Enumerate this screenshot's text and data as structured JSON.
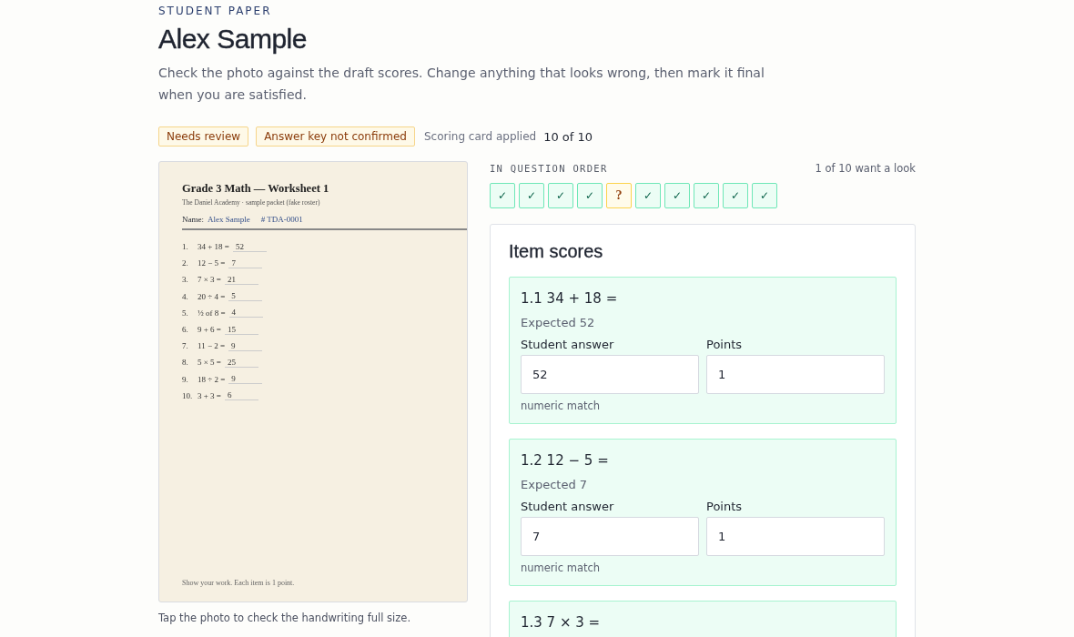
{
  "eyebrow": "STUDENT PAPER",
  "title": "Alex Sample",
  "intro": "Check the photo against the draft scores. Change anything that looks wrong, then mark it final when you are satisfied.",
  "badges": [
    "Needs review",
    "Answer key not confirmed"
  ],
  "scoring": {
    "label": "Scoring card applied",
    "value": "10 of 10"
  },
  "worksheet": {
    "title": "Grade 3 Math — Worksheet 1",
    "subtitle": "The Daniel Academy · sample packet (fake roster)",
    "name_label": "Name:",
    "name": "Alex Sample",
    "id": "# TDA-0001",
    "problems": [
      {
        "number": "1.",
        "question": "34 + 18 =",
        "answer": "52"
      },
      {
        "number": "2.",
        "question": "12 − 5 =",
        "answer": "7"
      },
      {
        "number": "3.",
        "question": "7 × 3 =",
        "answer": "21"
      },
      {
        "number": "4.",
        "question": "20 ÷ 4 =",
        "answer": "5"
      },
      {
        "number": "5.",
        "question": "½ of 8 =",
        "answer": "4"
      },
      {
        "number": "6.",
        "question": "9 + 6 =",
        "answer": "15"
      },
      {
        "number": "7.",
        "question": "11 − 2 =",
        "answer": "9"
      },
      {
        "number": "8.",
        "question": "5 × 5 =",
        "answer": "25"
      },
      {
        "number": "9.",
        "question": "18 ÷ 2 =",
        "answer": "9"
      },
      {
        "number": "10.",
        "question": "3 + 3 =",
        "answer": "6"
      }
    ],
    "footer": "Show your work. Each item is 1 point."
  },
  "photo_hint": "Tap the photo to check the handwriting full size.",
  "order": {
    "label": "IN QUESTION ORDER",
    "summary": "1 of 10 want a look",
    "chips": [
      {
        "kind": "ok",
        "glyph": "✓"
      },
      {
        "kind": "ok",
        "glyph": "✓"
      },
      {
        "kind": "ok",
        "glyph": "✓"
      },
      {
        "kind": "ok",
        "glyph": "✓"
      },
      {
        "kind": "flag",
        "glyph": "?"
      },
      {
        "kind": "ok",
        "glyph": "✓"
      },
      {
        "kind": "ok",
        "glyph": "✓"
      },
      {
        "kind": "ok",
        "glyph": "✓"
      },
      {
        "kind": "ok",
        "glyph": "✓"
      },
      {
        "kind": "ok",
        "glyph": "✓"
      }
    ]
  },
  "items": {
    "title": "Item scores",
    "list": [
      {
        "heading": "1.1 34 + 18 =",
        "expected": "Expected 52",
        "answer_label": "Student answer",
        "answer": "52",
        "points_label": "Points",
        "points": "1",
        "method": "numeric match"
      },
      {
        "heading": "1.2 12 − 5 =",
        "expected": "Expected 7",
        "answer_label": "Student answer",
        "answer": "7",
        "points_label": "Points",
        "points": "1",
        "method": "numeric match"
      },
      {
        "heading": "1.3 7 × 3 ="
      }
    ]
  }
}
